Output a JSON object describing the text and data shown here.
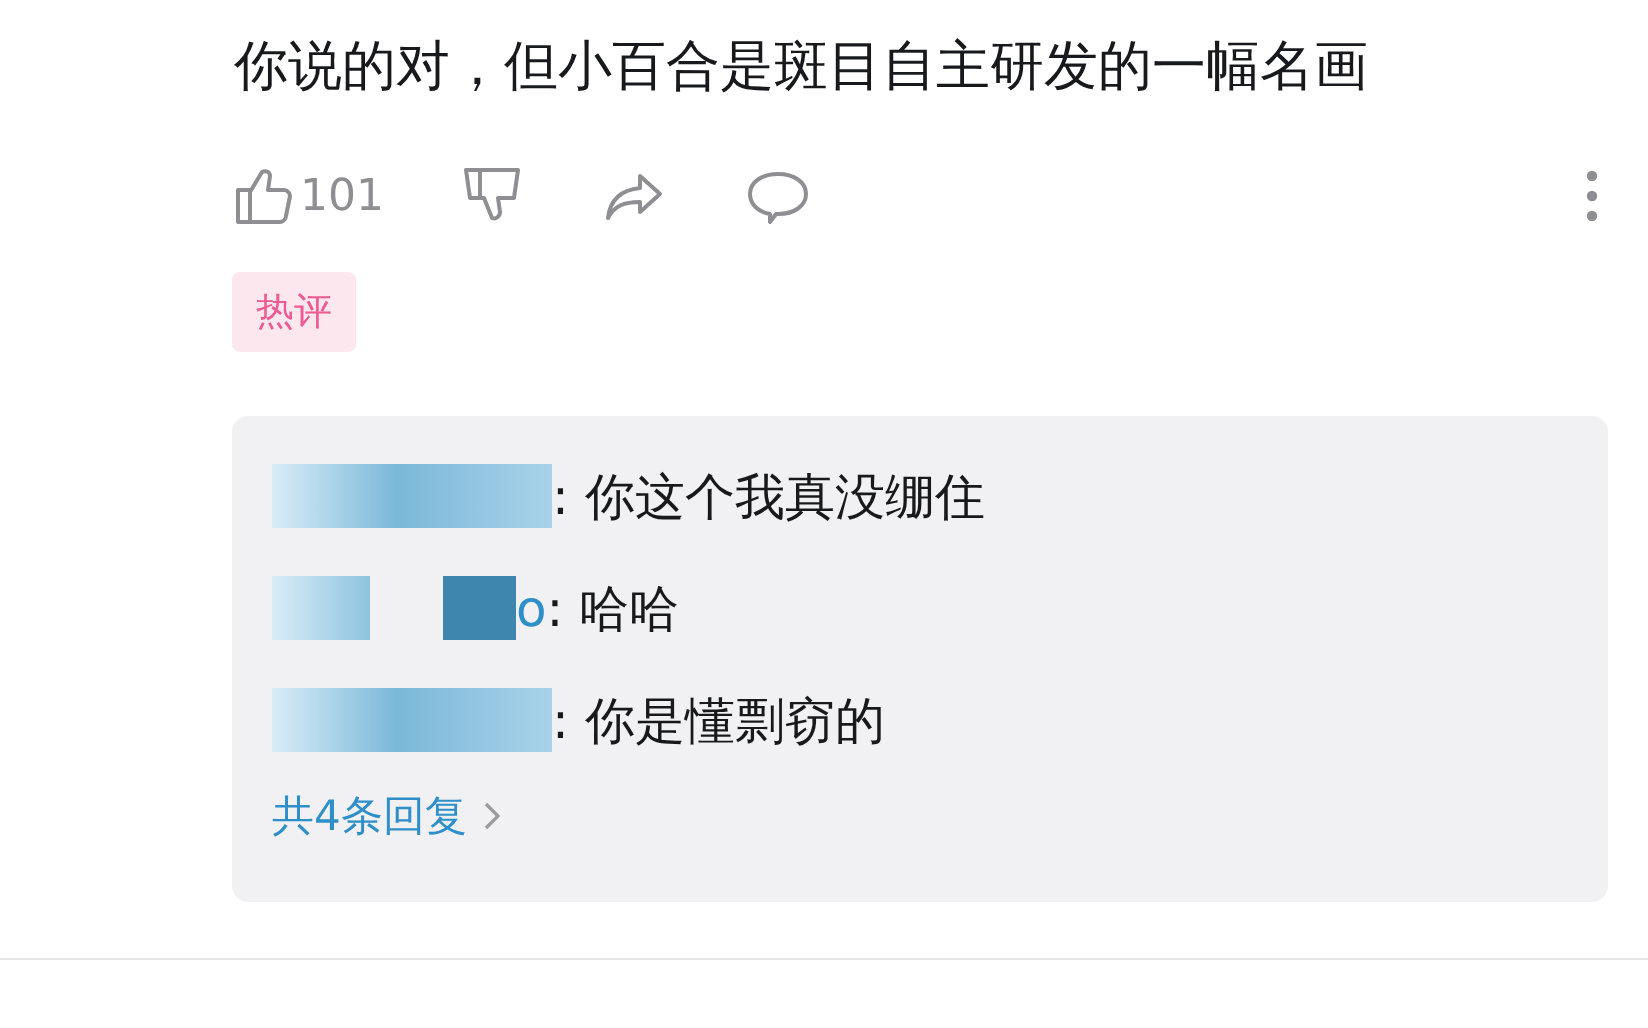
{
  "comment": {
    "text": "你说的对，但小百合是斑目自主研发的一幅名画"
  },
  "actions": {
    "like_count": "101"
  },
  "tag": "热评",
  "replies": [
    {
      "text": ": 你这个我真没绷住"
    },
    {
      "name_tail": "o",
      "text": ": 哈哈"
    },
    {
      "text": ": 你是懂剽窃的"
    }
  ],
  "more_replies": "共4条回复"
}
